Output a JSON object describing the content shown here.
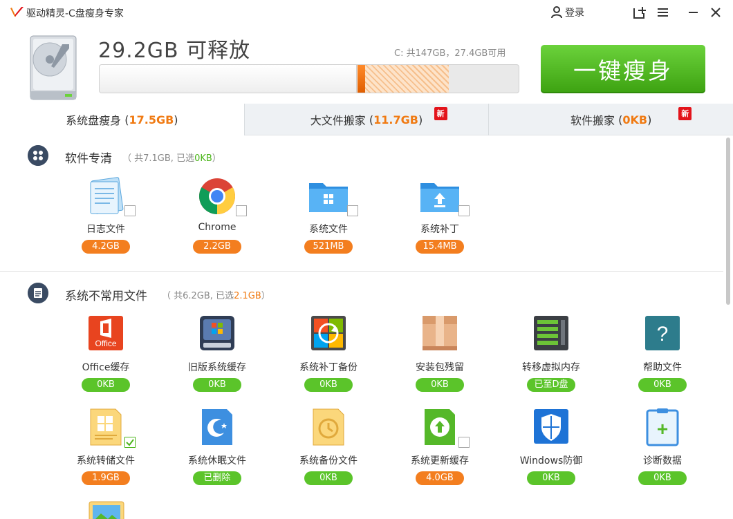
{
  "window": {
    "title": "驱动精灵-C盘瘦身专家",
    "login_label": "登录"
  },
  "header": {
    "free_text": "29.2GB 可释放",
    "disk_info": "C: 共147GB，27.4GB可用",
    "slim_button": "一键瘦身",
    "progress": {
      "used_fraction": 0.614,
      "releasable_fraction": 0.199
    }
  },
  "tabs": [
    {
      "name": "系统盘瘦身",
      "size": "17.5GB",
      "open": "(",
      "close": ")",
      "active": true,
      "new": false
    },
    {
      "name": "大文件搬家",
      "size": "11.7GB",
      "open": "(",
      "close": ")",
      "active": false,
      "new": true
    },
    {
      "name": "软件搬家",
      "size": "0KB",
      "open": "(",
      "close": ")",
      "active": false,
      "new": true
    }
  ],
  "new_badge": "新",
  "sections": [
    {
      "title": "软件专清",
      "sub_prefix": "（ 共7.1GB, 已选",
      "sub_value": "0KB",
      "sub_suffix": "）",
      "items": [
        {
          "label": "日志文件",
          "size": "4.2GB",
          "badge": "orange",
          "icon": "log-file-icon",
          "checked": false
        },
        {
          "label": "Chrome",
          "size": "2.2GB",
          "badge": "orange",
          "icon": "chrome-icon",
          "checked": false
        },
        {
          "label": "系统文件",
          "size": "521MB",
          "badge": "orange",
          "icon": "system-folder-icon",
          "checked": false
        },
        {
          "label": "系统补丁",
          "size": "15.4MB",
          "badge": "orange",
          "icon": "patch-folder-icon",
          "checked": false
        }
      ]
    },
    {
      "title": "系统不常用文件",
      "sub_prefix": "（ 共6.2GB, 已选",
      "sub_value": "2.1GB",
      "sub_suffix": "）",
      "items": [
        {
          "label": "Office缓存",
          "size": "0KB",
          "badge": "green",
          "icon": "office-icon",
          "checked": null,
          "icon_text": "Office"
        },
        {
          "label": "旧版系统缓存",
          "size": "0KB",
          "badge": "green",
          "icon": "old-windows-icon",
          "checked": null
        },
        {
          "label": "系统补丁备份",
          "size": "0KB",
          "badge": "green",
          "icon": "patch-backup-icon",
          "checked": null
        },
        {
          "label": "安装包残留",
          "size": "0KB",
          "badge": "green",
          "icon": "package-box-icon",
          "checked": null
        },
        {
          "label": "转移虚拟内存",
          "size": "已至D盘",
          "badge": "green",
          "icon": "virtual-memory-icon",
          "checked": null
        },
        {
          "label": "帮助文件",
          "size": "0KB",
          "badge": "green",
          "icon": "help-file-icon",
          "checked": null,
          "icon_text": "?"
        },
        {
          "label": "系统转储文件",
          "size": "1.9GB",
          "badge": "orange",
          "icon": "dump-file-icon",
          "checked": true
        },
        {
          "label": "系统休眠文件",
          "size": "已删除",
          "badge": "green",
          "icon": "hibernate-file-icon",
          "checked": null
        },
        {
          "label": "系统备份文件",
          "size": "0KB",
          "badge": "green",
          "icon": "backup-file-icon",
          "checked": null
        },
        {
          "label": "系统更新缓存",
          "size": "4.0GB",
          "badge": "orange",
          "icon": "update-cache-icon",
          "checked": false
        },
        {
          "label": "Windows防御",
          "size": "0KB",
          "badge": "green",
          "icon": "windows-defender-icon",
          "checked": null
        },
        {
          "label": "诊断数据",
          "size": "0KB",
          "badge": "green",
          "icon": "diagnostic-data-icon",
          "checked": null,
          "icon_text": "+"
        }
      ]
    }
  ],
  "colors": {
    "accent_orange": "#f37e1f",
    "accent_green": "#5bc42a",
    "button_green": "#4db320",
    "new_red": "#e3141b"
  }
}
